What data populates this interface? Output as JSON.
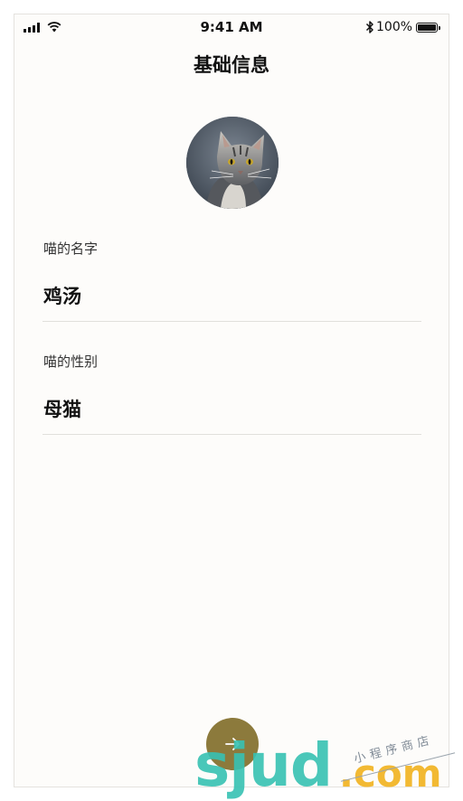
{
  "status_bar": {
    "time": "9:41 AM",
    "battery": "100%"
  },
  "header": {
    "title": "基础信息"
  },
  "avatar": {
    "alt": "cat"
  },
  "fields": [
    {
      "label": "喵的名字",
      "value": "鸡汤"
    },
    {
      "label": "喵的性别",
      "value": "母猫"
    }
  ],
  "watermark": {
    "brand": "sjud",
    "domain": ".com",
    "tag": "小程序商店"
  },
  "colors": {
    "background": "#fdfcfa",
    "next_button": "#8c7a3c",
    "watermark_teal": "#37c2b3",
    "watermark_yellow": "#f2b933"
  }
}
